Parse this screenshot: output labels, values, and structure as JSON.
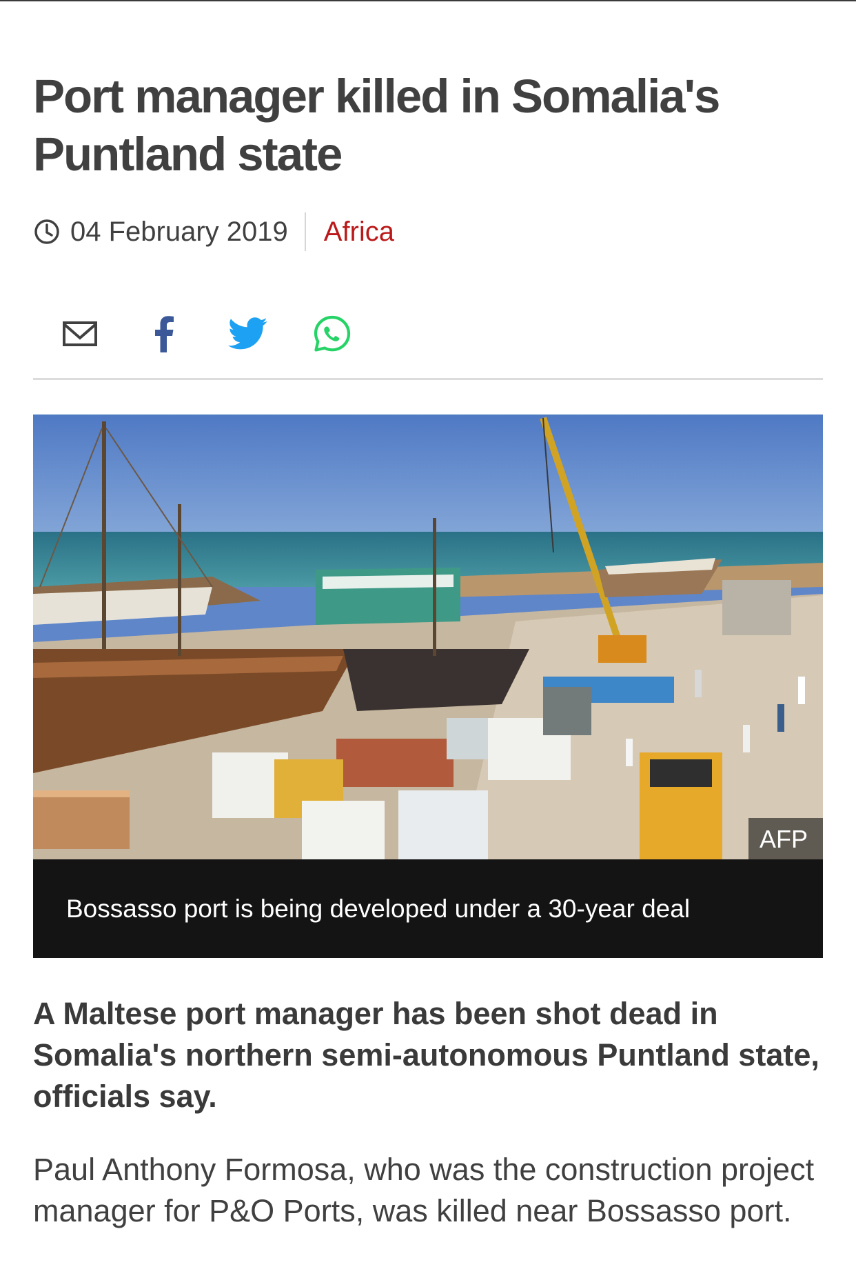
{
  "article": {
    "headline": "Port manager killed in Somalia's Puntland state",
    "date": "04 February 2019",
    "section": "Africa",
    "colors": {
      "section": "#bb1919",
      "facebook": "#3b5998",
      "twitter": "#1da1f2",
      "whatsapp": "#25d366"
    },
    "share": [
      {
        "icon": "email-icon"
      },
      {
        "icon": "facebook-icon"
      },
      {
        "icon": "twitter-icon"
      },
      {
        "icon": "whatsapp-icon"
      }
    ],
    "image": {
      "credit": "AFP",
      "caption": "Bossasso port is being developed under a 30-year deal"
    },
    "intro": "A Maltese port manager has been shot dead in Somalia's northern semi-autonomous Puntland state, officials say.",
    "paragraph": "Paul Anthony Formosa, who was the construction project manager for P&O Ports, was killed near Bossasso port."
  }
}
